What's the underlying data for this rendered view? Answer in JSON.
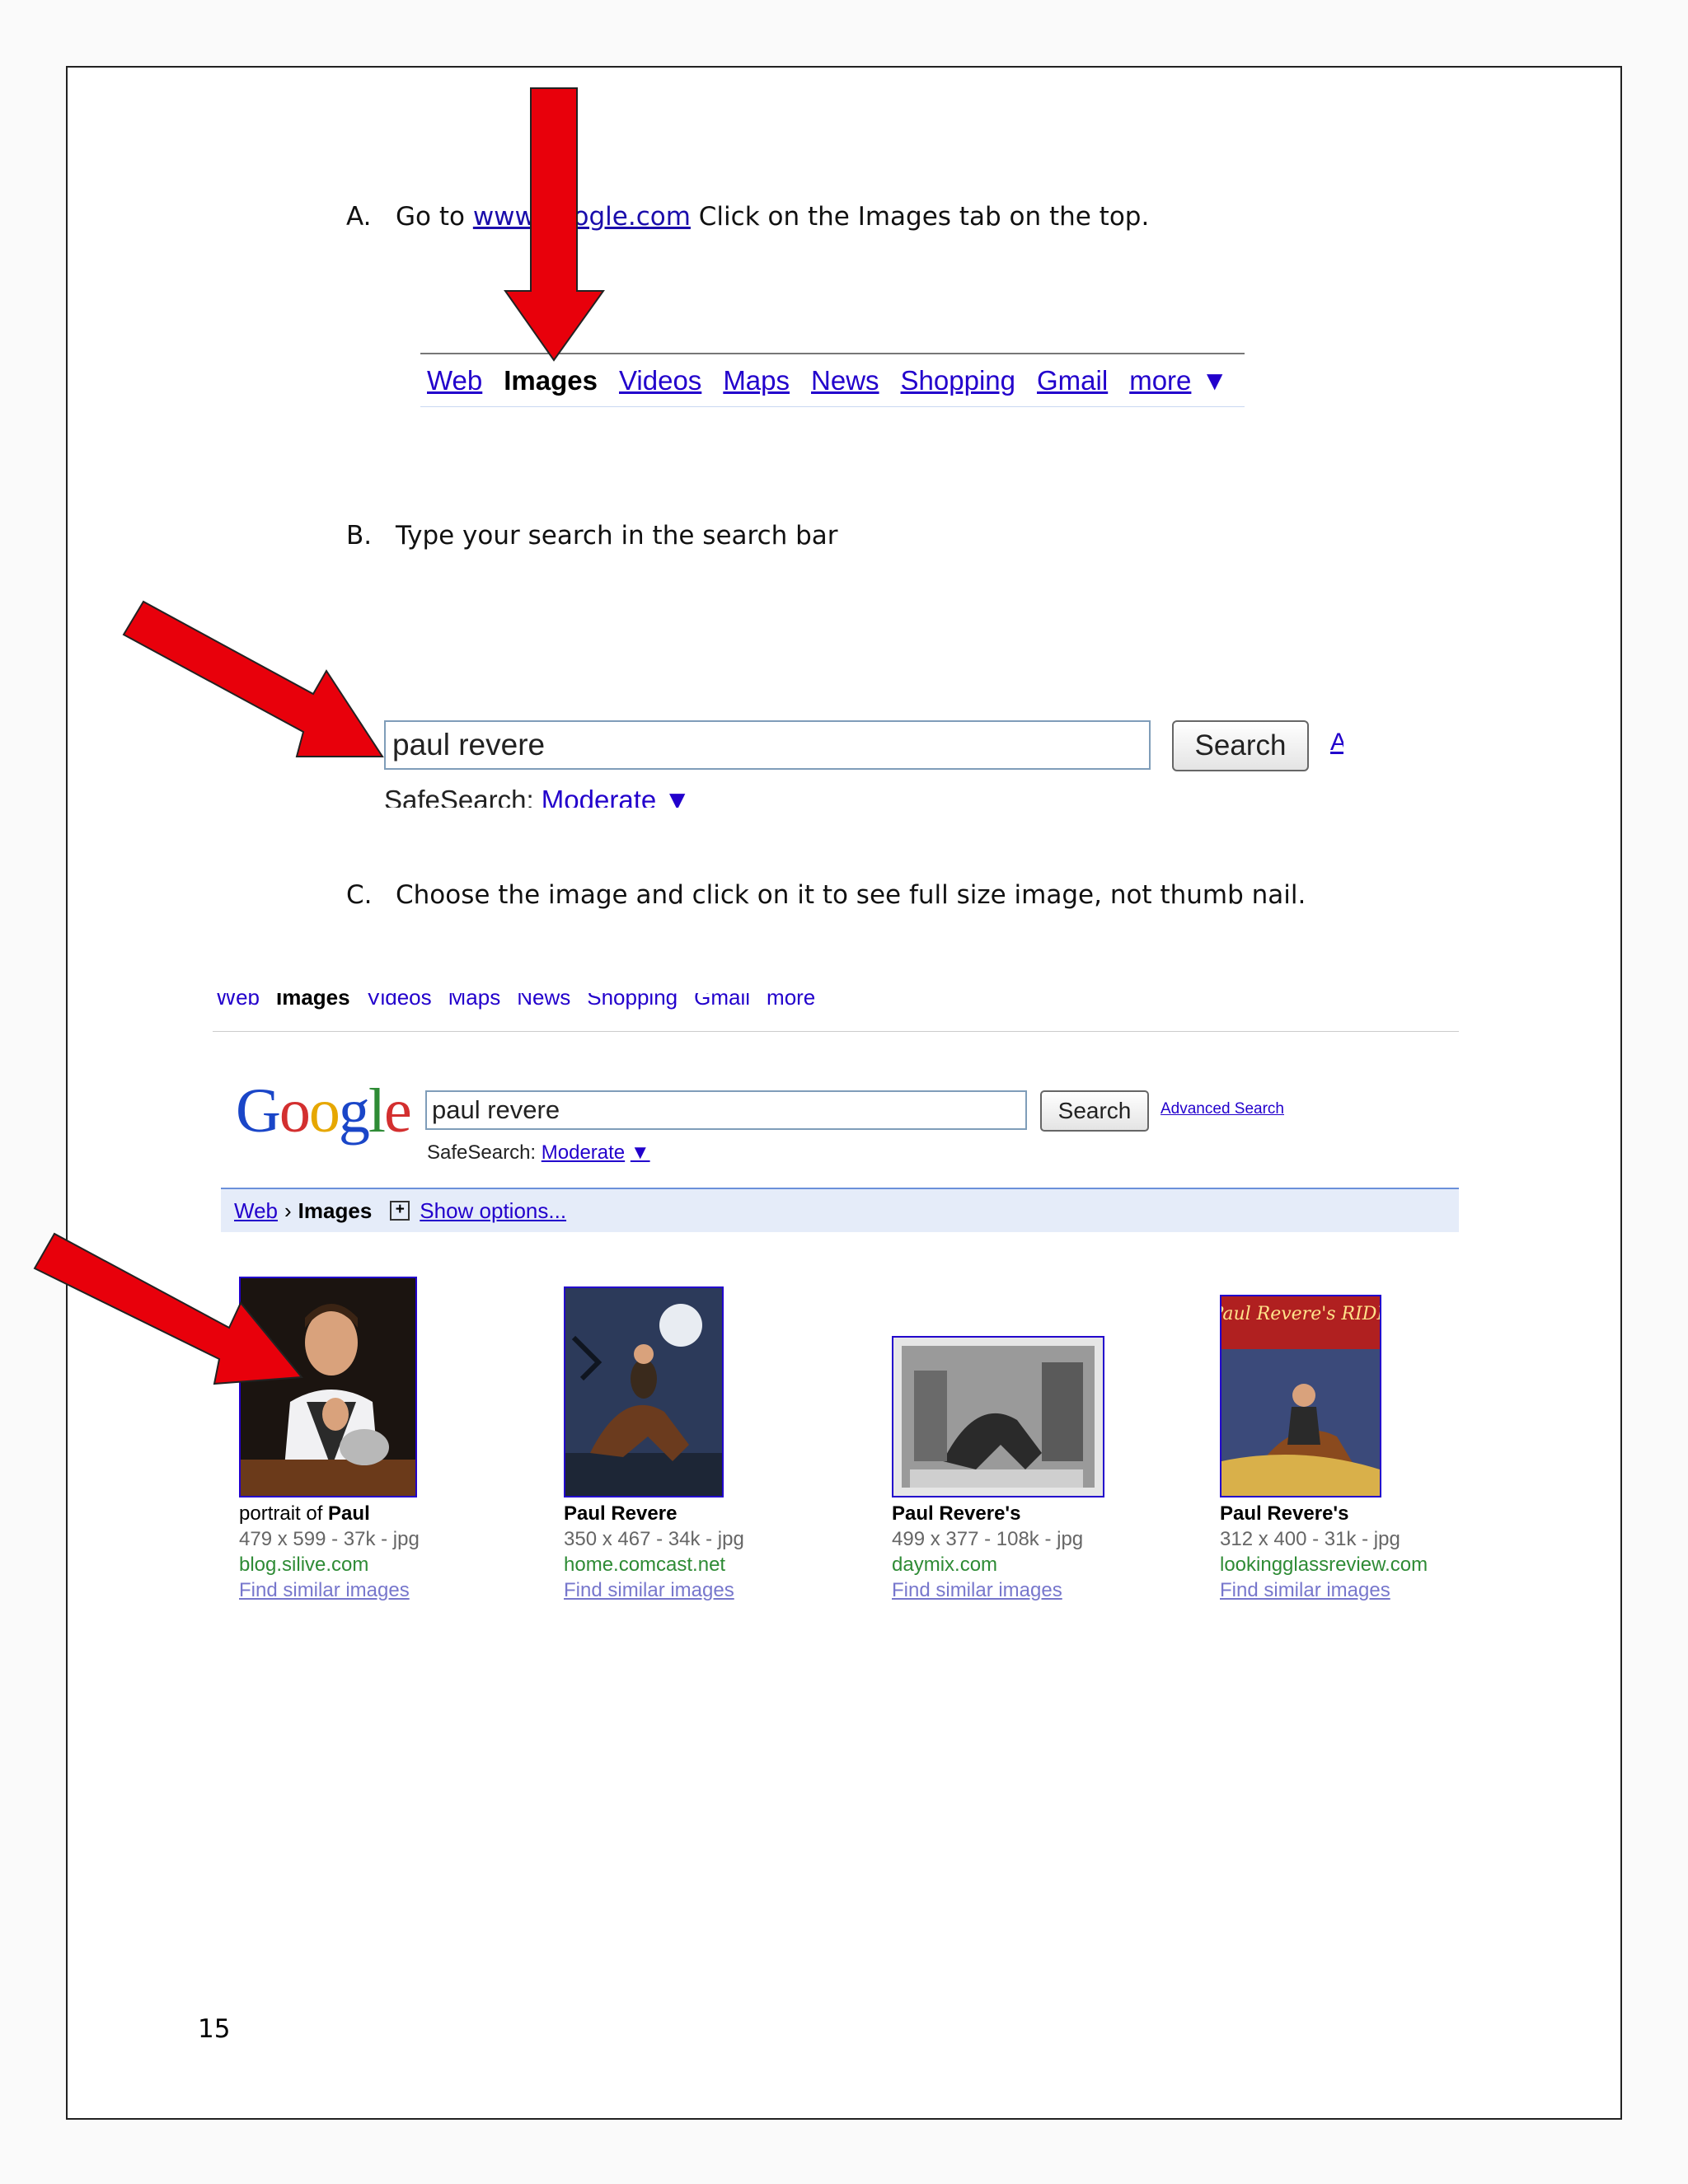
{
  "steps": [
    {
      "letter": "A.",
      "pre": "Go to ",
      "link": "www.google.com",
      "post": " Click on the Images tab on the top."
    },
    {
      "letter": "B.",
      "text": "Type your search in the search bar"
    },
    {
      "letter": "C.",
      "text": "Choose the image and click on it to see full size image, not thumb nail."
    }
  ],
  "nav": {
    "web": "Web",
    "images": "Images",
    "videos": "Videos",
    "maps": "Maps",
    "news": "News",
    "shopping": "Shopping",
    "gmail": "Gmail",
    "more": "more"
  },
  "search": {
    "query": "paul revere",
    "button": "Search",
    "advanced": "Advanced Search",
    "safesearch_label": "SafeSearch:",
    "safesearch_value": "Moderate"
  },
  "breadcrumb": {
    "web": "Web",
    "sep": "›",
    "images": "Images",
    "options": "Show options..."
  },
  "results": [
    {
      "title_pre": "portrait of ",
      "title_bold": "Paul",
      "meta": "479 x 599 - 37k - jpg",
      "site": "blog.silive.com",
      "similar": "Find similar images"
    },
    {
      "title_pre": "",
      "title_bold": "Paul Revere",
      "meta": "350 x 467 - 34k - jpg",
      "site": "home.comcast.net",
      "similar": "Find similar images"
    },
    {
      "title_pre": "",
      "title_bold": "Paul Revere's",
      "meta": "499 x 377 - 108k - jpg",
      "site": "daymix.com",
      "similar": "Find similar images"
    },
    {
      "title_pre": "",
      "title_bold": "Paul Revere's",
      "meta": "312 x 400 - 31k - jpg",
      "site": "lookingglassreview.com",
      "similar": "Find similar images"
    }
  ],
  "comic_title": "Paul Revere's RIDE",
  "page_number": "15",
  "colors": {
    "link": "#2200cc",
    "arrow": "#e8000b",
    "site": "#2e8b35"
  }
}
